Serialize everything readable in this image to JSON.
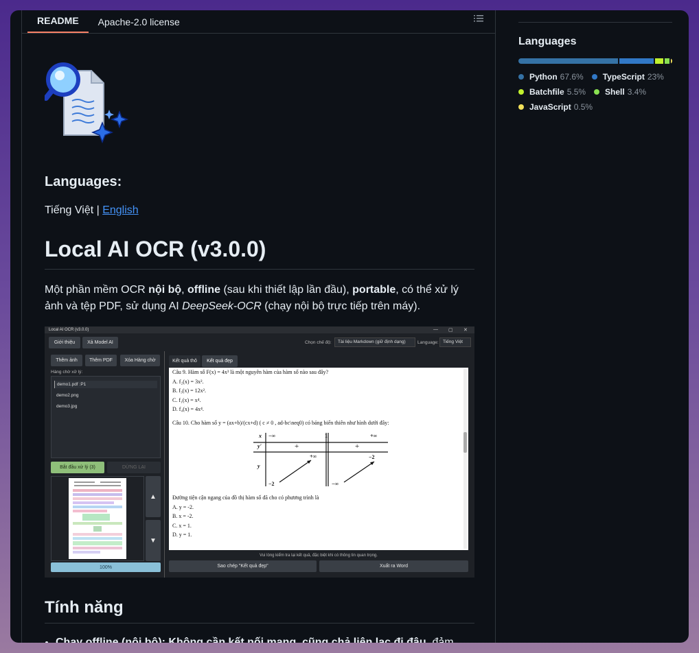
{
  "tabs": {
    "readme": "README",
    "license": "Apache-2.0 license"
  },
  "readme": {
    "languages_heading": "Languages:",
    "lang_vi": "Tiếng Việt",
    "lang_sep": " | ",
    "lang_en": "English",
    "title": "Local AI OCR (v3.0.0)",
    "desc": {
      "t1": "Một phần mềm OCR ",
      "b1": "nội bộ",
      "t2": ", ",
      "b2": "offline",
      "t3": " (sau khi thiết lập lần đầu), ",
      "b3": "portable",
      "t4": ", có thể xử lý ảnh và tệp PDF, sử dụng AI ",
      "i1": "DeepSeek-OCR",
      "t5": " (chạy nội bộ trực tiếp trên máy)."
    },
    "features_heading": "Tính năng",
    "feature1_bold": "Chạy offline (nội bộ): Không cần kết nối mạng, cũng chả liên lạc đi đâu",
    "feature1_rest": ", đảm"
  },
  "screenshot": {
    "window_title": "Local AI OCR (v3.0.0)",
    "controls": [
      "—",
      "▢",
      "✕"
    ],
    "btn_intro": "Giới thiệu",
    "btn_delete_model": "Xả Model AI",
    "mode_label": "Chọn chế độ:",
    "mode_value": "Tài liệu Markdown (giữ định dạng)",
    "lang_label": "Language:",
    "lang_value": "Tiếng Việt",
    "btn_add_image": "Thêm ảnh",
    "btn_add_pdf": "Thêm PDF",
    "btn_clear_queue": "Xóa Hàng chờ",
    "queue_label": "Hàng chờ xử lý:",
    "queue": [
      "demo1.pdf :P1",
      "demo2.png",
      "demo3.jpg"
    ],
    "btn_start": "Bắt đầu xử lý (3)",
    "btn_stop": "DỪNG LẠI",
    "progress": "100%",
    "tab_raw": "Kết quả thô",
    "tab_pretty": "Kết quả đẹp",
    "doc_lines": [
      "Câu 9. Hàm số F(x) = 4x³ là một nguyên hàm của hàm số nào sau đây?",
      "A. f₂(x) = 3x².",
      "B. f₃(x) = 12x².",
      "C. f₁(x) = x⁴.",
      "D. f₄(x) = 4x⁴.",
      "Câu 10. Cho hàm số y = (ax+b)/(cx+d) ( c ≠ 0 , ad-bc\\neq0) có bảng biến thiên như hình dưới đây:"
    ],
    "var_table": {
      "x": "x",
      "yp": "y'",
      "y": "y",
      "neg_inf": "−∞",
      "one": "1",
      "pos_inf": "+∞",
      "plus": "+",
      "minus_two": "−2"
    },
    "doc_lines2": [
      "Đường tiện cận ngang của đồ thị hàm số đã cho có phương trình là",
      "A. y = -2.",
      "B. x = -2.",
      "C. x = 1.",
      "D. y = 1."
    ],
    "note": "Vui lòng kiểm tra lại kết quả, đặc biệt khi có thông tin quan trọng.",
    "btn_copy": "Sao chép \"Kết quả đẹp\"",
    "btn_export": "Xuất ra Word",
    "nav_up": "▲",
    "nav_down": "▼"
  },
  "sidebar": {
    "title": "Languages",
    "languages": [
      {
        "name": "Python",
        "pct": "67.6%",
        "value": 67.6,
        "color": "#3572A5"
      },
      {
        "name": "TypeScript",
        "pct": "23%",
        "value": 23.0,
        "color": "#3178c6"
      },
      {
        "name": "Batchfile",
        "pct": "5.5%",
        "value": 5.5,
        "color": "#C1F12E"
      },
      {
        "name": "Shell",
        "pct": "3.4%",
        "value": 3.4,
        "color": "#89e051"
      },
      {
        "name": "JavaScript",
        "pct": "0.5%",
        "value": 0.5,
        "color": "#f1e05a"
      }
    ]
  }
}
